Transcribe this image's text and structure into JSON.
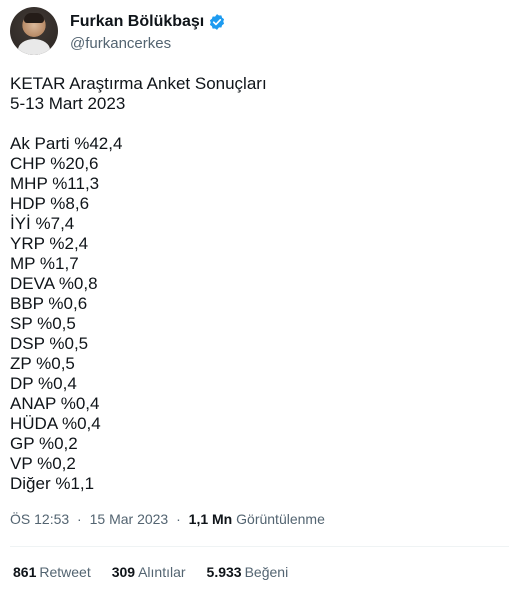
{
  "author": {
    "display_name": "Furkan Bölükbaşı",
    "handle": "@furkancerkes",
    "verified_icon": "verified-badge-icon",
    "verified_color": "#1d9bf0"
  },
  "tweet": {
    "title_line": "KETAR Araştırma Anket Sonuçları",
    "date_line": "5-13 Mart 2023",
    "results": [
      "Ak Parti %42,4",
      "CHP %20,6",
      "MHP %11,3",
      "HDP %8,6",
      "İYİ %7,4",
      "YRP %2,4",
      "MP %1,7",
      "DEVA %0,8",
      "BBP %0,6",
      "SP %0,5",
      "DSP %0,5",
      "ZP %0,5",
      "DP %0,4",
      "ANAP %0,4",
      "HÜDA %0,4",
      "GP %0,2",
      "VP %0,2",
      "Diğer %1,1"
    ]
  },
  "meta": {
    "time": "ÖS 12:53",
    "separator": "·",
    "date": "15 Mar 2023",
    "views_count": "1,1 Mn",
    "views_label": "Görüntülenme"
  },
  "stats": {
    "retweets_count": "861",
    "retweets_label": "Retweet",
    "quotes_count": "309",
    "quotes_label": "Alıntılar",
    "likes_count": "5.933",
    "likes_label": "Beğeni"
  }
}
